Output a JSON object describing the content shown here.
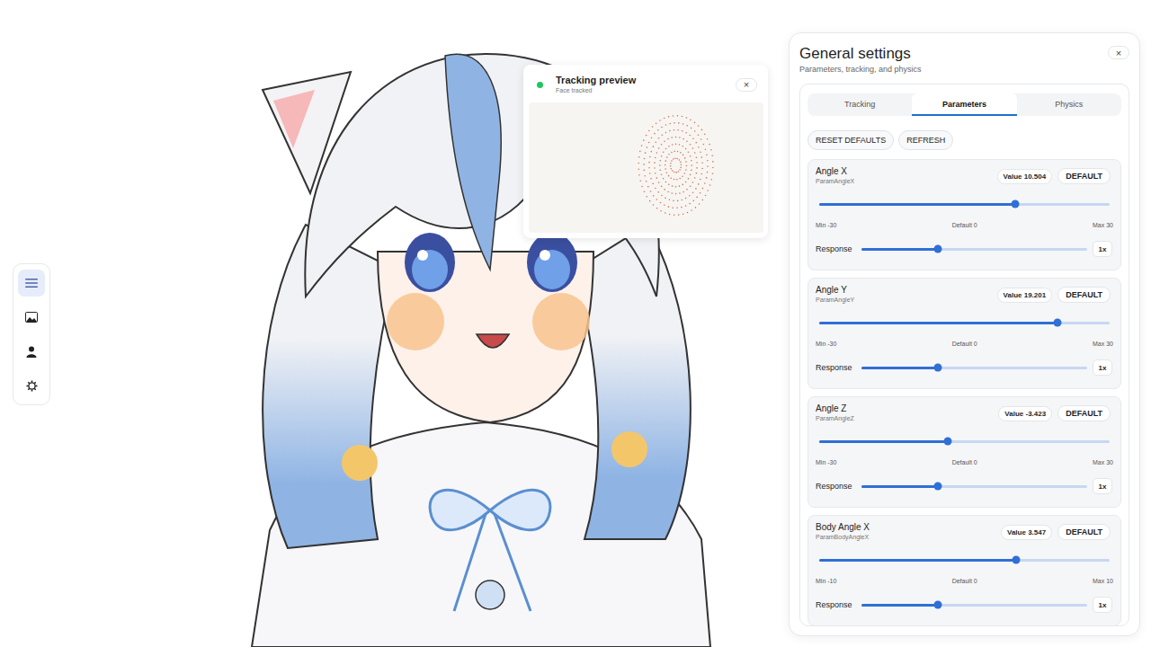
{
  "toolbar": {
    "items": [
      {
        "kind": "menu",
        "selected": true
      },
      {
        "kind": "image",
        "selected": false
      },
      {
        "kind": "person",
        "selected": false
      },
      {
        "kind": "gear",
        "selected": false
      }
    ]
  },
  "tracking_preview": {
    "title": "Tracking preview",
    "status": "Face tracked",
    "tracked": true,
    "close": "×"
  },
  "settings": {
    "title": "General settings",
    "subtitle": "Parameters, tracking, and physics",
    "close": "×",
    "tabs": [
      {
        "label": "Tracking",
        "selected": false
      },
      {
        "label": "Parameters",
        "selected": true
      },
      {
        "label": "Physics",
        "selected": false
      }
    ],
    "actions": [
      "RESET DEFAULTS",
      "REFRESH"
    ],
    "parameters": [
      {
        "name": "Angle X",
        "id": "ParamAngleX",
        "value": "Value 10.504",
        "default_button": "DEFAULT",
        "level": 0.675,
        "min": "Min -30",
        "default": "Default 0",
        "max": "Max 30",
        "response_label": "Response",
        "response_level": 0.337,
        "response": "1x"
      },
      {
        "name": "Angle Y",
        "id": "ParamAngleY",
        "value": "Value 19.201",
        "default_button": "DEFAULT",
        "level": 0.82,
        "min": "Min -30",
        "default": "Default 0",
        "max": "Max 30",
        "response_label": "Response",
        "response_level": 0.337,
        "response": "1x"
      },
      {
        "name": "Angle Z",
        "id": "ParamAngleZ",
        "value": "Value -3.423",
        "default_button": "DEFAULT",
        "level": 0.443,
        "min": "Min -30",
        "default": "Default 0",
        "max": "Max 30",
        "response_label": "Response",
        "response_level": 0.337,
        "response": "1x"
      },
      {
        "name": "Body Angle X",
        "id": "ParamBodyAngleX",
        "value": "Value 3.547",
        "default_button": "DEFAULT",
        "level": 0.677,
        "min": "Min -10",
        "default": "Default 0",
        "max": "Max 10",
        "response_label": "Response",
        "response_level": 0.337,
        "response": "1x"
      }
    ]
  }
}
